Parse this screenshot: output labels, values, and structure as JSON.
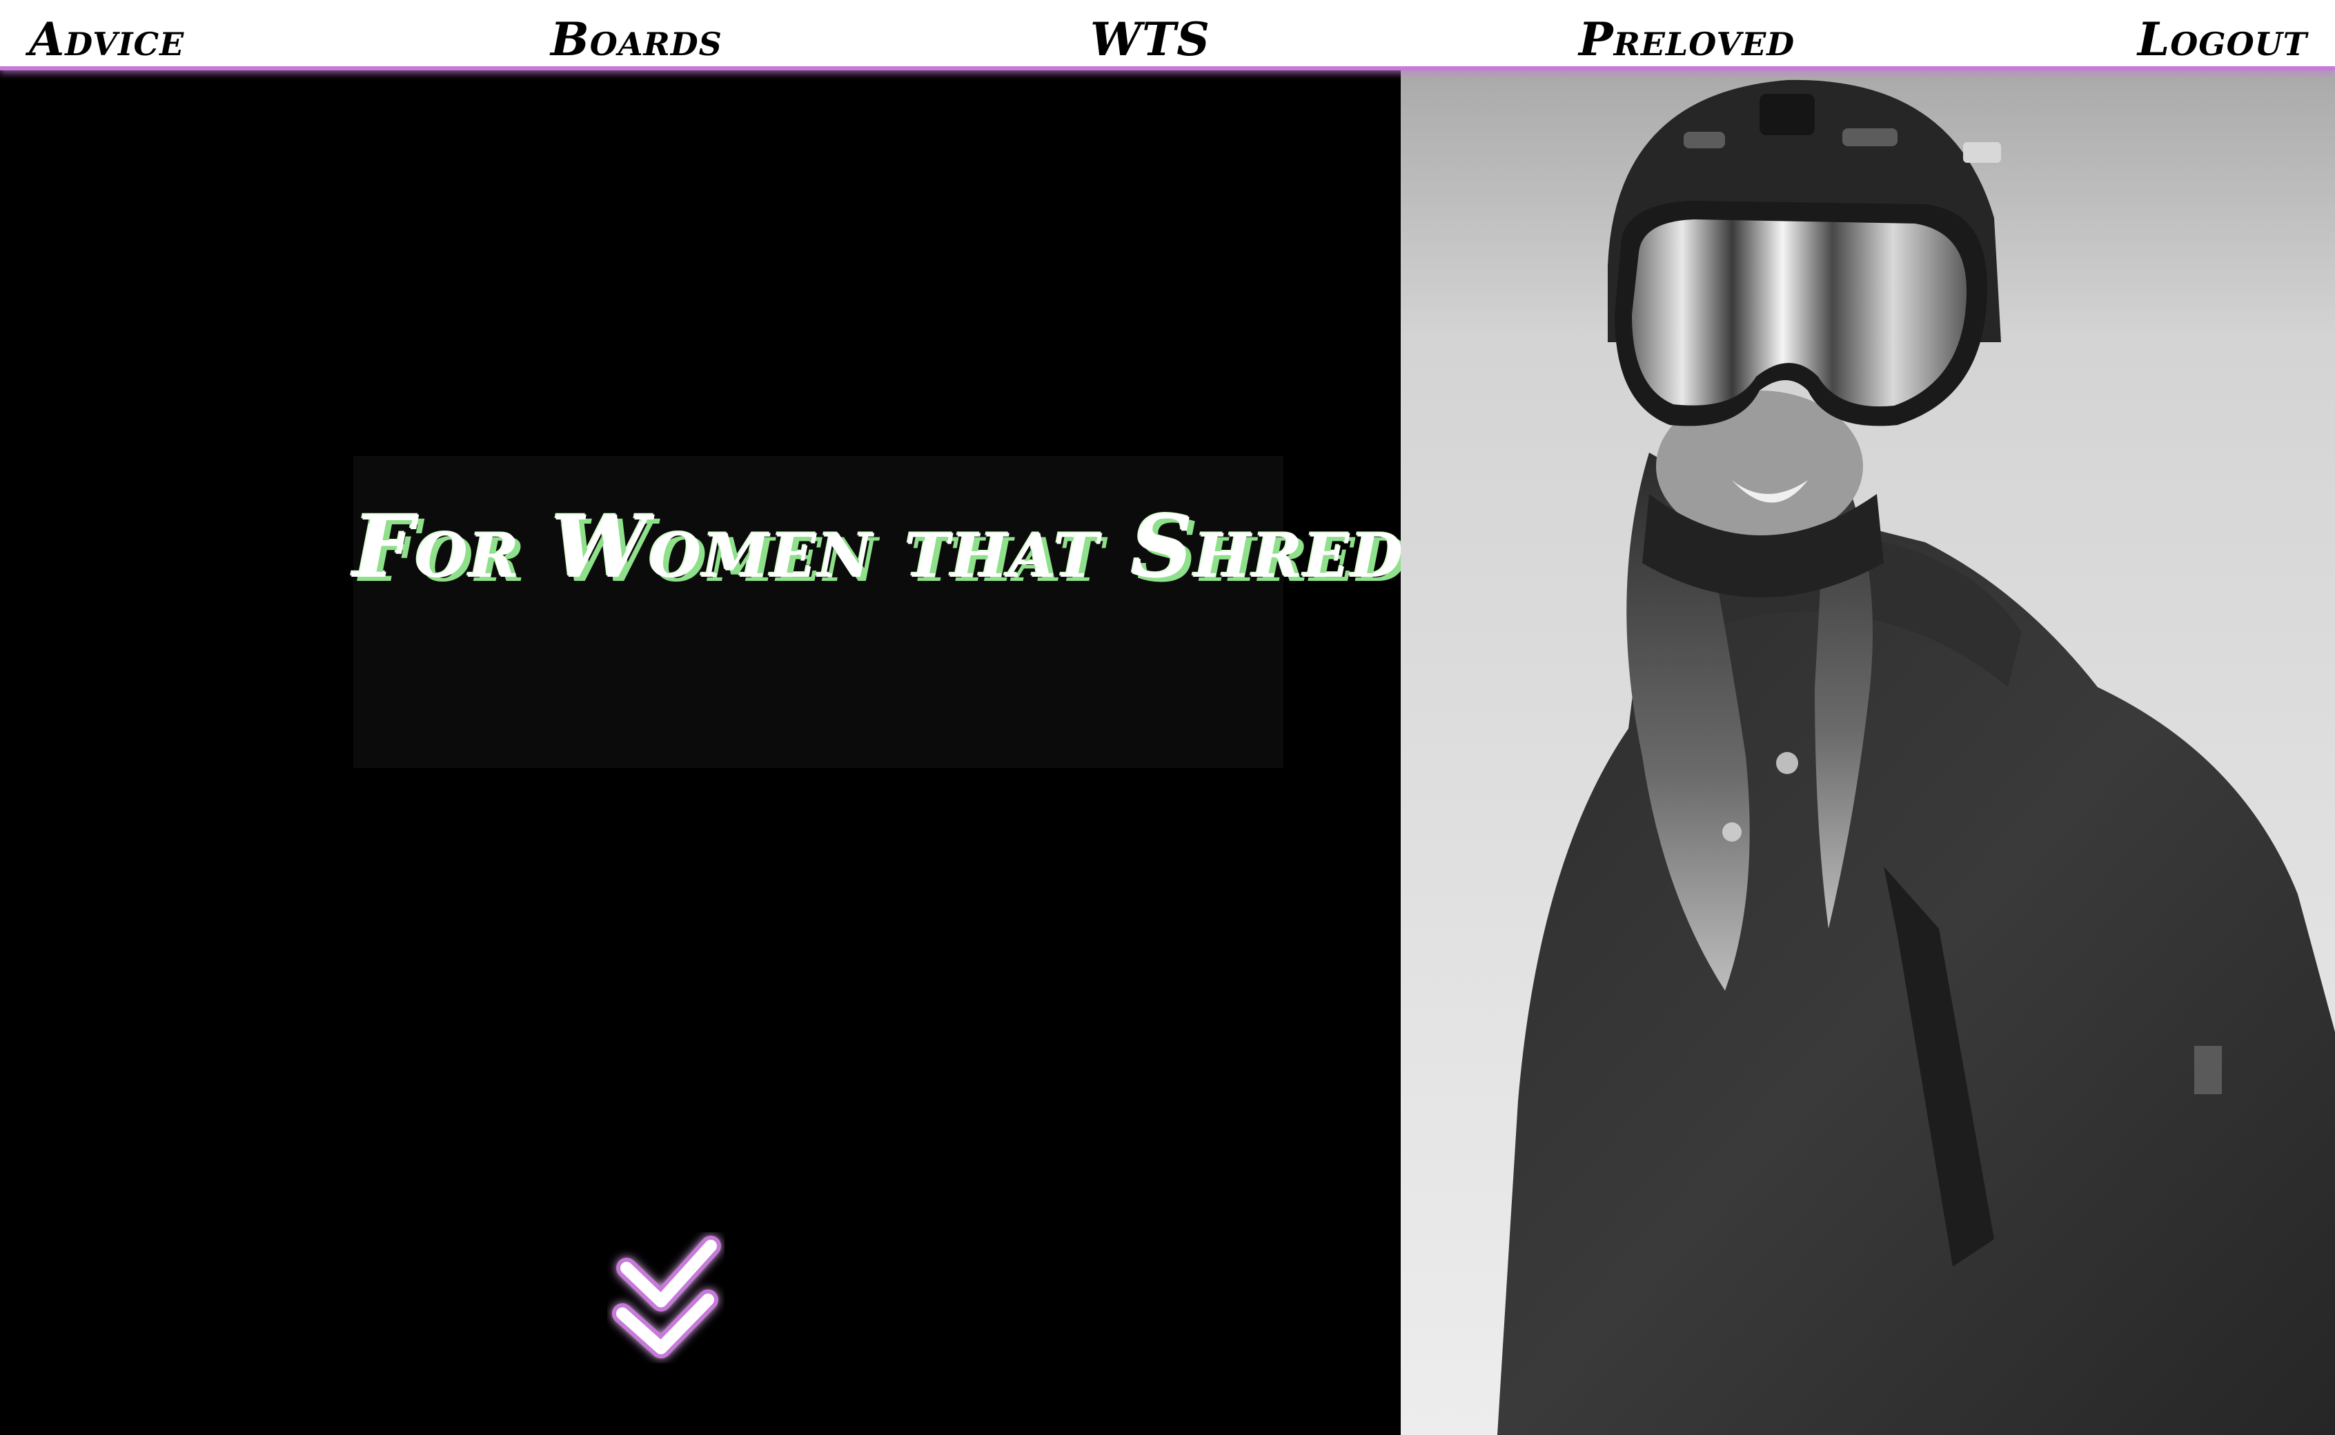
{
  "nav": {
    "items": [
      {
        "label": "Advice"
      },
      {
        "label": "Boards"
      },
      {
        "label": "WTS"
      },
      {
        "label": "Preloved"
      },
      {
        "label": "Logout"
      }
    ]
  },
  "hero": {
    "tagline": "For Women that Shred",
    "scroll_icon": "double-chevron-down-icon"
  },
  "photo": {
    "subject": "snowboarder-portrait"
  },
  "colors": {
    "accent": "#c77ad9",
    "tagline_shadow": "#8fe08a",
    "hero_bg": "#000000",
    "nav_bg": "#ffffff"
  }
}
